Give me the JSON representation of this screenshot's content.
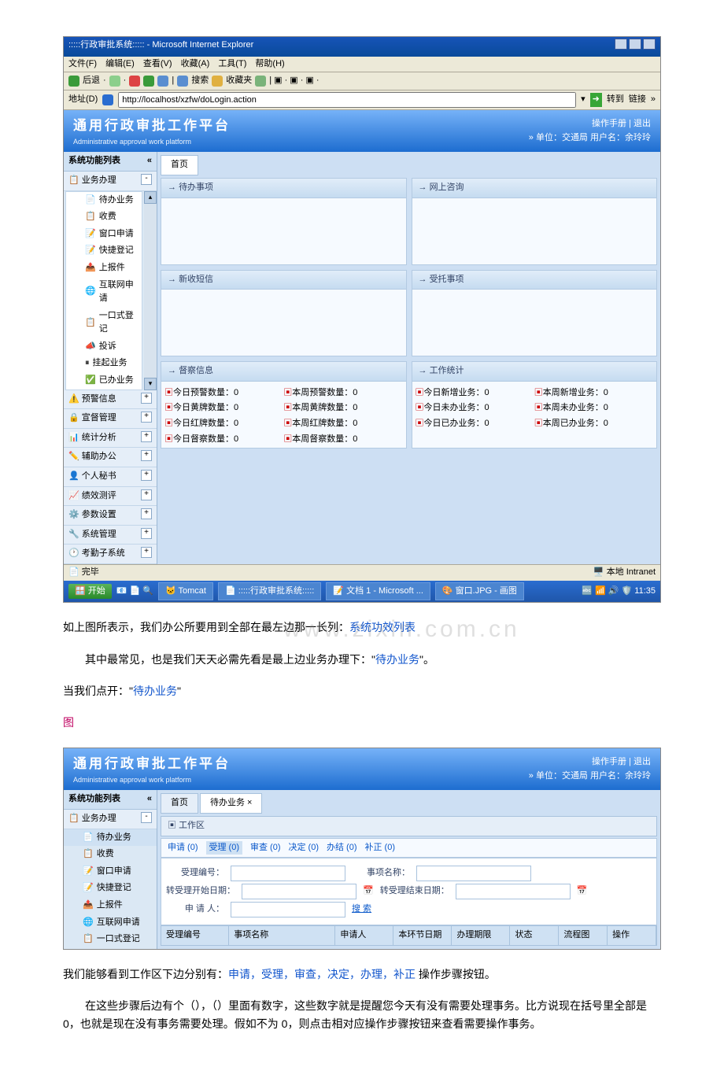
{
  "s1": {
    "title": ":::::行政审批系统::::: - Microsoft Internet Explorer",
    "menus": [
      "文件(F)",
      "编辑(E)",
      "查看(V)",
      "收藏(A)",
      "工具(T)",
      "帮助(H)"
    ],
    "tb": {
      "back": "后退",
      "search": "搜索",
      "fav": "收藏夹"
    },
    "addrLabel": "地址(D)",
    "url": "http://localhost/xzfw/doLogin.action",
    "go": "转到",
    "links": "链接",
    "bannerTitle": "通用行政审批工作平台",
    "bannerSub": "Administrative approval work platform",
    "ulink": "操作手册 | 退出",
    "uinfo": "» 单位：交通局 用户名：余玲玲",
    "sideTitle": "系统功能列表",
    "cats": [
      "业务办理",
      "预警信息",
      "宣督管理",
      "统计分析",
      "辅助办公",
      "个人秘书",
      "绩效测评",
      "参数设置",
      "系统管理",
      "考勤子系统"
    ],
    "items": [
      "待办业务",
      "收费",
      "窗口申请",
      "快捷登记",
      "上报件",
      "互联网申请",
      "一口式登记",
      "投诉",
      "挂起业务",
      "已办业务"
    ],
    "homeTab": "首页",
    "panels": {
      "p1": "待办事项",
      "p2": "网上咨询",
      "p3": "新收短信",
      "p4": "受托事项",
      "p5": "督察信息",
      "p6": "工作统计"
    },
    "stats": {
      "a": [
        "今日预警数量：0",
        "本周预警数量：0"
      ],
      "b": [
        "今日黄牌数量：0",
        "本周黄牌数量：0"
      ],
      "c": [
        "今日红牌数量：0",
        "本周红牌数量：0"
      ],
      "d": [
        "今日督察数量：0",
        "本周督察数量：0"
      ],
      "e": [
        "今日新增业务：0",
        "本周新增业务：0"
      ],
      "f": [
        "今日未办业务：0",
        "本周未办业务：0"
      ],
      "g": [
        "今日已办业务：0",
        "本周已办业务：0"
      ]
    },
    "done": "完毕",
    "intranet": "本地 Intranet",
    "taskbar": {
      "start": "开始",
      "t1": "Tomcat",
      "t2": ":::::行政审批系统:::::",
      "t3": "文档 1 - Microsoft ...",
      "t4": "窗口.JPG - 画图",
      "time": "11:35"
    }
  },
  "d1": {
    "p1a": "如上图所表示，我们办公所要用到全部在最左边那一长列：",
    "p1b": "系统功效列表",
    "p2a": "其中最常见，也是我们天天必需先看是最上边业务办理下：\"",
    "p2b": "待办业务",
    "p2c": "\"。",
    "p3a": "当我们点开：\"",
    "p3b": "待办业务",
    "p3c": "\"",
    "pic": "图"
  },
  "s2": {
    "bannerTitle": "通用行政审批工作平台",
    "bannerSub": "Administrative approval work platform",
    "ulink": "操作手册 | 退出",
    "uinfo": "» 单位：交通局 用户名：余玲玲",
    "sideTitle": "系统功能列表",
    "cat": "业务办理",
    "items": [
      "待办业务",
      "收费",
      "窗口申请",
      "快捷登记",
      "上报件",
      "互联网申请",
      "一口式登记"
    ],
    "tabs": [
      "首页",
      "待办业务 ×"
    ],
    "work": "工作区",
    "steps": [
      "申请 (0)",
      "受理 (0)",
      "审查 (0)",
      "决定 (0)",
      "办结 (0)",
      "补正 (0)"
    ],
    "f": {
      "bh": "受理编号：",
      "mc": "事项名称：",
      "ks": "转受理开始日期：",
      "js": "转受理结束日期：",
      "sq": "申 请 人：",
      "ss": "搜 索"
    },
    "th": [
      "受理编号",
      "事项名称",
      "申请人",
      "本环节日期",
      "办理期限",
      "状态",
      "流程图",
      "操作"
    ]
  },
  "d2": {
    "p1a": "我们能够看到工作区下边分别有：",
    "p1b": "申请，受理，审查，决定，办理，补正",
    "p1c": " 操作步骤按钮。",
    "p2": "在这些步骤后边有个（），（）里面有数字，这些数字就是提醒您今天有没有需要处理事务。比方说现在括号里全部是 0，也就是现在没有事务需要处理。假如不为 0，则点击相对应操作步骤按钮来查看需要操作事务。"
  }
}
